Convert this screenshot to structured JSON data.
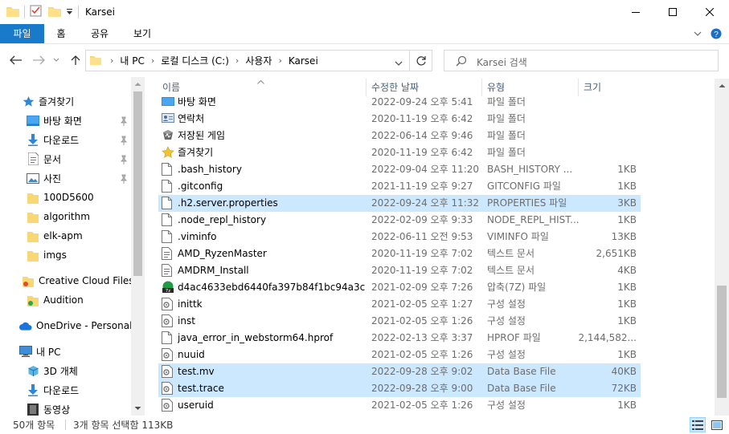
{
  "window": {
    "title": "Karsei",
    "icons": [
      "folder-icon",
      "properties-icon",
      "new-folder-icon",
      "customize-quick-access-icon"
    ]
  },
  "ribbon": {
    "tabs": [
      {
        "label": "파일"
      },
      {
        "label": "홈"
      },
      {
        "label": "공유"
      },
      {
        "label": "보기"
      }
    ]
  },
  "address": {
    "crumbs": [
      "내 PC",
      "로컬 디스크 (C:)",
      "사용자",
      "Karsei"
    ]
  },
  "search": {
    "placeholder": "Karsei 검색"
  },
  "nav": {
    "quick_access": "즐겨찾기",
    "quick_items": [
      {
        "label": "바탕 화면",
        "pinned": true
      },
      {
        "label": "다운로드",
        "pinned": true
      },
      {
        "label": "문서",
        "pinned": true
      },
      {
        "label": "사진",
        "pinned": true
      },
      {
        "label": "100D5600",
        "pinned": false
      },
      {
        "label": "algorithm",
        "pinned": false
      },
      {
        "label": "elk-apm",
        "pinned": false
      },
      {
        "label": "imgs",
        "pinned": false
      }
    ],
    "creative_cloud": "Creative Cloud Files",
    "audition": "Audition",
    "onedrive": "OneDrive - Personal",
    "this_pc": "내 PC",
    "pc_items": [
      {
        "label": "3D 개체"
      },
      {
        "label": "다운로드"
      },
      {
        "label": "동영상"
      }
    ]
  },
  "columns": {
    "name": "이름",
    "date": "수정한 날짜",
    "type": "유형",
    "size": "크기"
  },
  "files": [
    {
      "name": "바탕 화면",
      "date": "2022-09-24 오후 5:41",
      "type": "파일 폴더",
      "size": "",
      "icon": "desktop-folder",
      "selected": false
    },
    {
      "name": "연락처",
      "date": "2020-11-19 오후 6:42",
      "type": "파일 폴더",
      "size": "",
      "icon": "contacts-folder",
      "selected": false
    },
    {
      "name": "저장된 게임",
      "date": "2022-06-14 오후 9:46",
      "type": "파일 폴더",
      "size": "",
      "icon": "saved-games-folder",
      "selected": false
    },
    {
      "name": "즐겨찾기",
      "date": "2020-11-19 오후 6:42",
      "type": "파일 폴더",
      "size": "",
      "icon": "favorites-folder",
      "selected": false
    },
    {
      "name": ".bash_history",
      "date": "2022-09-04 오후 11:20",
      "type": "BASH_HISTORY ...",
      "size": "1KB",
      "icon": "file",
      "selected": false
    },
    {
      "name": ".gitconfig",
      "date": "2021-11-19 오후 9:27",
      "type": "GITCONFIG 파일",
      "size": "1KB",
      "icon": "file",
      "selected": false
    },
    {
      "name": ".h2.server.properties",
      "date": "2022-09-24 오후 11:32",
      "type": "PROPERTIES 파일",
      "size": "3KB",
      "icon": "file",
      "selected": true
    },
    {
      "name": ".node_repl_history",
      "date": "2022-02-09 오후 9:33",
      "type": "NODE_REPL_HIST...",
      "size": "1KB",
      "icon": "file",
      "selected": false
    },
    {
      "name": ".viminfo",
      "date": "2022-06-11 오전 9:53",
      "type": "VIMINFO 파일",
      "size": "13KB",
      "icon": "file",
      "selected": false
    },
    {
      "name": "AMD_RyzenMaster",
      "date": "2020-11-19 오후 7:02",
      "type": "텍스트 문서",
      "size": "2,651KB",
      "icon": "text",
      "selected": false
    },
    {
      "name": "AMDRM_Install",
      "date": "2020-11-19 오후 7:02",
      "type": "텍스트 문서",
      "size": "4KB",
      "icon": "text",
      "selected": false
    },
    {
      "name": "d4ac4633ebd6440fa397b84f1bc94a3c",
      "date": "2021-02-09 오후 7:26",
      "type": "압축(7Z) 파일",
      "size": "1KB",
      "icon": "archive",
      "selected": false
    },
    {
      "name": "inittk",
      "date": "2021-02-05 오후 1:27",
      "type": "구성 설정",
      "size": "1KB",
      "icon": "config",
      "selected": false
    },
    {
      "name": "inst",
      "date": "2021-02-05 오후 1:26",
      "type": "구성 설정",
      "size": "1KB",
      "icon": "config",
      "selected": false
    },
    {
      "name": "java_error_in_webstorm64.hprof",
      "date": "2022-02-13 오후 3:37",
      "type": "HPROF 파일",
      "size": "2,144,582...",
      "icon": "file",
      "selected": false
    },
    {
      "name": "nuuid",
      "date": "2021-02-05 오후 1:26",
      "type": "구성 설정",
      "size": "1KB",
      "icon": "config",
      "selected": false
    },
    {
      "name": "test.mv",
      "date": "2022-09-28 오후 9:02",
      "type": "Data Base File",
      "size": "40KB",
      "icon": "config",
      "selected": true
    },
    {
      "name": "test.trace",
      "date": "2022-09-28 오후 9:00",
      "type": "Data Base File",
      "size": "72KB",
      "icon": "config",
      "selected": true
    },
    {
      "name": "useruid",
      "date": "2021-02-05 오후 1:26",
      "type": "구성 설정",
      "size": "1KB",
      "icon": "config",
      "selected": false
    }
  ],
  "status": {
    "count": "50개 항목",
    "selection": "3개 항목 선택함 113KB"
  },
  "colors": {
    "accent": "#1979ca",
    "selection": "#cce8ff",
    "header_text": "#4c607a",
    "muted_text": "#6d6d6d"
  }
}
